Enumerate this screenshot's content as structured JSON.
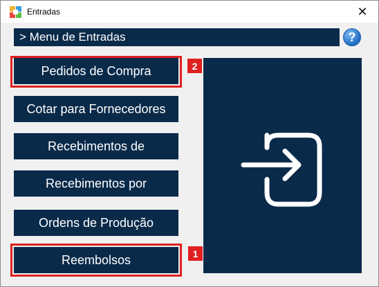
{
  "window": {
    "title": "Entradas",
    "close_glyph": "✕"
  },
  "header": {
    "prefix": ">",
    "title": "Menu de Entradas",
    "help_glyph": "?"
  },
  "menu": {
    "buttons": [
      {
        "label": "Pedidos de Compra"
      },
      {
        "label": "Cotar para Fornecedores"
      },
      {
        "label": "Recebimentos de"
      },
      {
        "label": "Recebimentos por"
      },
      {
        "label": "Ordens de Produção"
      },
      {
        "label": "Reembolsos"
      }
    ]
  },
  "annotations": [
    {
      "number": "2",
      "target": "Pedidos de Compra"
    },
    {
      "number": "1",
      "target": "Reembolsos"
    }
  ],
  "colors": {
    "accent": "#0a2a4a",
    "highlight": "#e02020",
    "help": "#1f6cc4"
  },
  "icons": {
    "app": "app-logo-icon",
    "panel": "login-arrow-icon"
  }
}
